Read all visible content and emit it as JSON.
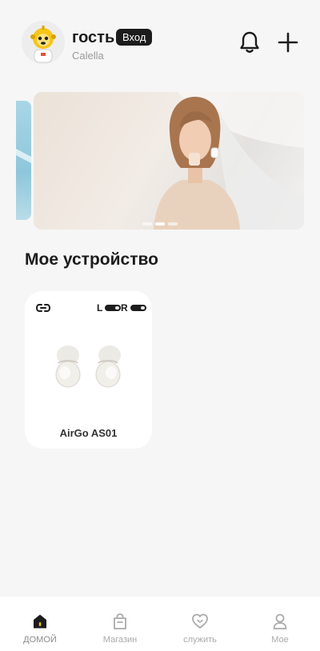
{
  "header": {
    "user_name": "гость",
    "login_label": "Вход",
    "brand": "Calella"
  },
  "banner": {
    "slides": 3,
    "active_slide": 2
  },
  "devices_section": {
    "title": "Мое устройство",
    "devices": [
      {
        "name": "AirGo AS01",
        "battery_left_label": "L",
        "battery_right_label": "R"
      }
    ]
  },
  "nav": {
    "items": [
      {
        "label": "ДОМОЙ",
        "icon": "home-icon",
        "active": true
      },
      {
        "label": "Магазин",
        "icon": "shopping-bag-icon",
        "active": false
      },
      {
        "label": "служить",
        "icon": "heart-icon",
        "active": false
      },
      {
        "label": "Мое",
        "icon": "profile-icon",
        "active": false
      }
    ]
  },
  "colors": {
    "background": "#f6f6f6",
    "card": "#ffffff",
    "text_primary": "#1c1c1c",
    "text_secondary": "#9a9a9a",
    "active_home_dot": "#f2c200"
  }
}
